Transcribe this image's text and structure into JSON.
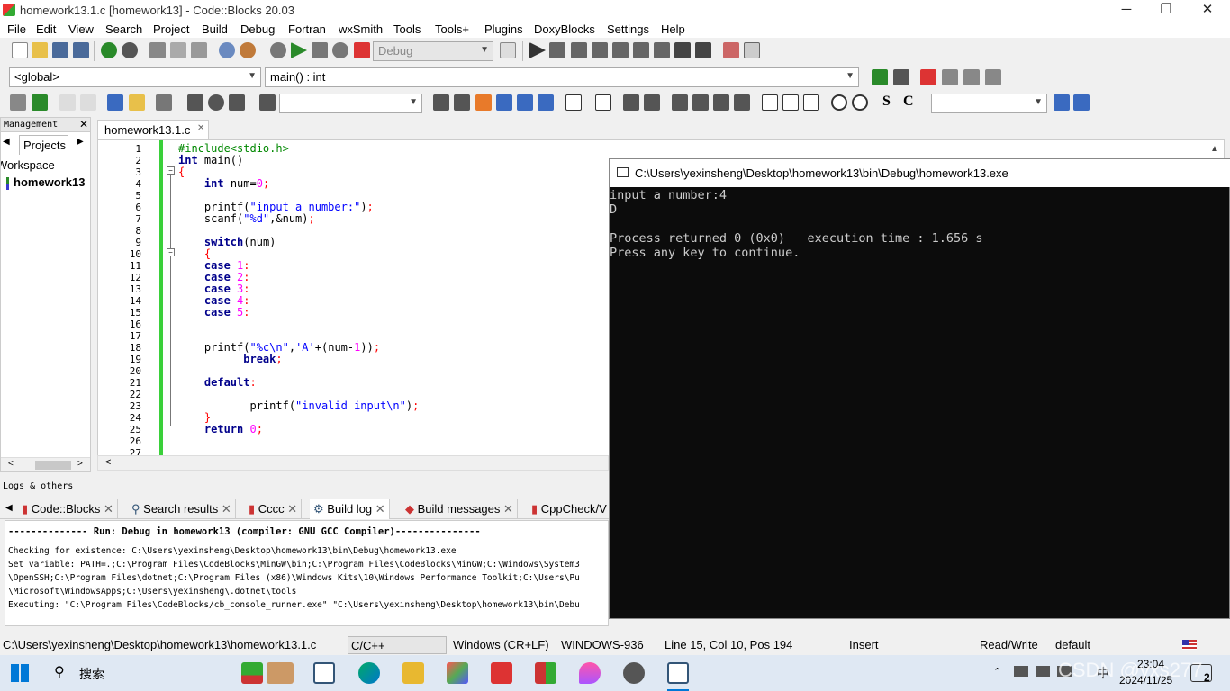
{
  "window": {
    "title": "homework13.1.c [homework13] - Code::Blocks 20.03",
    "min": "─",
    "max": "❐",
    "close": "✕"
  },
  "menu": [
    "File",
    "Edit",
    "View",
    "Search",
    "Project",
    "Build",
    "Debug",
    "Fortran",
    "wxSmith",
    "Tools",
    "Tools+",
    "Plugins",
    "DoxyBlocks",
    "Settings",
    "Help"
  ],
  "toolbar": {
    "build_target": "Debug",
    "scope": "<global>",
    "function": "main() : int",
    "text_s": "S",
    "text_c": "C"
  },
  "management": {
    "title": "Management",
    "close": "✕",
    "tab": "Projects",
    "workspace": "Workspace",
    "project": "homework13"
  },
  "editor": {
    "tab": "homework13.1.c",
    "tab_close": "✕",
    "lines": [
      "1",
      "2",
      "3",
      "4",
      "5",
      "6",
      "7",
      "8",
      "9",
      "10",
      "11",
      "12",
      "13",
      "14",
      "15",
      "16",
      "17",
      "18",
      "19",
      "20",
      "21",
      "22",
      "23",
      "24",
      "25",
      "26",
      "27"
    ]
  },
  "console": {
    "title": "C:\\Users\\yexinsheng\\Desktop\\homework13\\bin\\Debug\\homework13.exe",
    "lines": [
      "input a number:4",
      "D",
      "",
      "Process returned 0 (0x0)   execution time : 1.656 s",
      "Press any key to continue."
    ]
  },
  "logs": {
    "title": "Logs & others",
    "tabs": [
      "Code::Blocks",
      "Search results",
      "Cccc",
      "Build log",
      "Build messages",
      "CppCheck/V"
    ],
    "lines": [
      "-------------- Run: Debug in homework13 (compiler: GNU GCC Compiler)---------------",
      "Checking for existence: C:\\Users\\yexinsheng\\Desktop\\homework13\\bin\\Debug\\homework13.exe",
      "Set variable: PATH=.;C:\\Program Files\\CodeBlocks\\MinGW\\bin;C:\\Program Files\\CodeBlocks\\MinGW;C:\\Windows\\System3",
      "\\OpenSSH;C:\\Program Files\\dotnet;C:\\Program Files (x86)\\Windows Kits\\10\\Windows Performance Toolkit;C:\\Users\\Pu",
      "\\Microsoft\\WindowsApps;C:\\Users\\yexinsheng\\.dotnet\\tools",
      "Executing: \"C:\\Program Files\\CodeBlocks/cb_console_runner.exe\" \"C:\\Users\\yexinsheng\\Desktop\\homework13\\bin\\Debu"
    ]
  },
  "status": {
    "path": "C:\\Users\\yexinsheng\\Desktop\\homework13\\homework13.1.c",
    "lang": "C/C++",
    "eol": "Windows (CR+LF)",
    "enc": "WINDOWS-936",
    "pos": "Line 15, Col 10, Pos 194",
    "mode": "Insert",
    "rw": "Read/Write",
    "profile": "default"
  },
  "taskbar": {
    "search": "搜索",
    "time": "23:04",
    "date": "2024/11/25",
    "watermark": "CSDN @yxs277",
    "ime": "中",
    "badge": "2"
  },
  "colors": {
    "accent": "#0078d7",
    "keyword": "#00008b",
    "string": "#0000ff",
    "number": "#ff00ff",
    "console_bg": "#0c0c0c"
  }
}
